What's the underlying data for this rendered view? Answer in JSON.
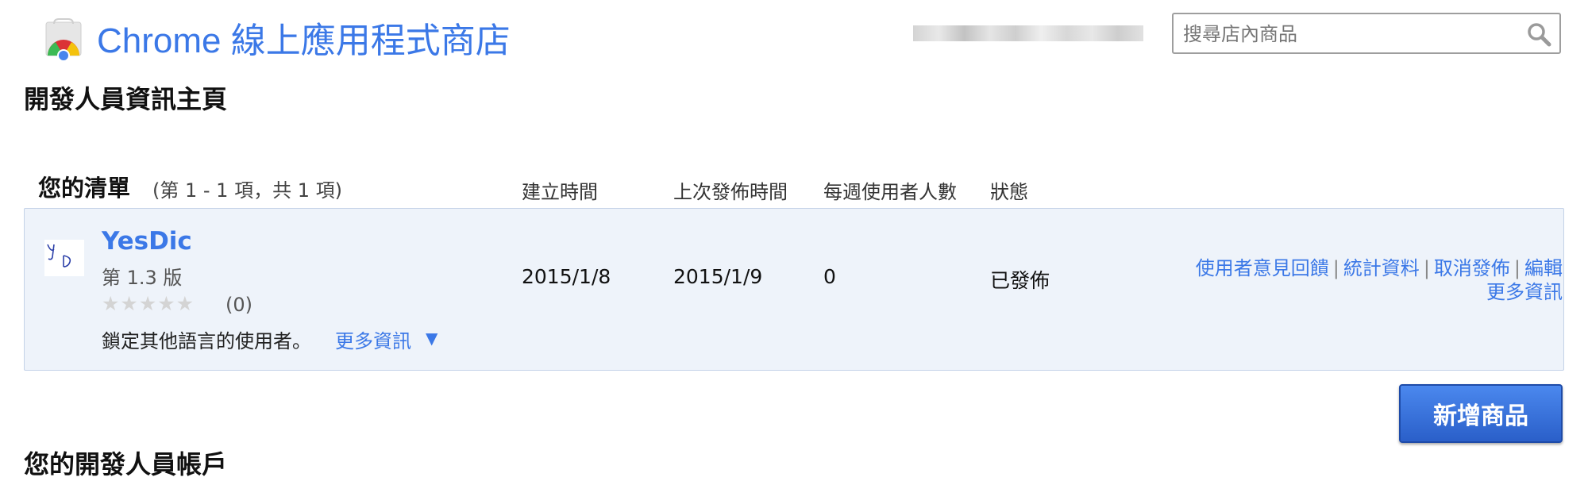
{
  "header": {
    "store_title": "Chrome 線上應用程式商店",
    "search_placeholder": "搜尋店內商品"
  },
  "page_heading": "開發人員資訊主頁",
  "list": {
    "title": "您的清單",
    "count": "(第 1 - 1 項，共 1 項)",
    "columns": {
      "created": "建立時間",
      "published": "上次發佈時間",
      "weekly_users": "每週使用者人數",
      "status": "狀態"
    },
    "items": [
      {
        "name": "YesDic",
        "version": "第 1.3 版",
        "stars": "★★★★★",
        "rating_count": "(0)",
        "target_text": "鎖定其他語言的使用者。",
        "more_info": "更多資訊",
        "more_arrow": "▼",
        "created": "2015/1/8",
        "published": "2015/1/9",
        "weekly_users": "0",
        "status": "已發佈",
        "actions": {
          "feedback": "使用者意見回饋",
          "stats": "統計資料",
          "unpublish": "取消發佈",
          "edit": "編輯",
          "more_info": "更多資訊",
          "separator": "|"
        }
      }
    ]
  },
  "add_item_label": "新增商品",
  "account_heading": "您的開發人員帳戶",
  "colors": {
    "link": "#3b78e7",
    "panel_bg": "#eef3fa",
    "button": "#2a5fc9"
  },
  "icons": [
    "chrome-web-store-logo",
    "search-icon",
    "app-icon-yesdic",
    "dropdown-arrow-icon"
  ]
}
